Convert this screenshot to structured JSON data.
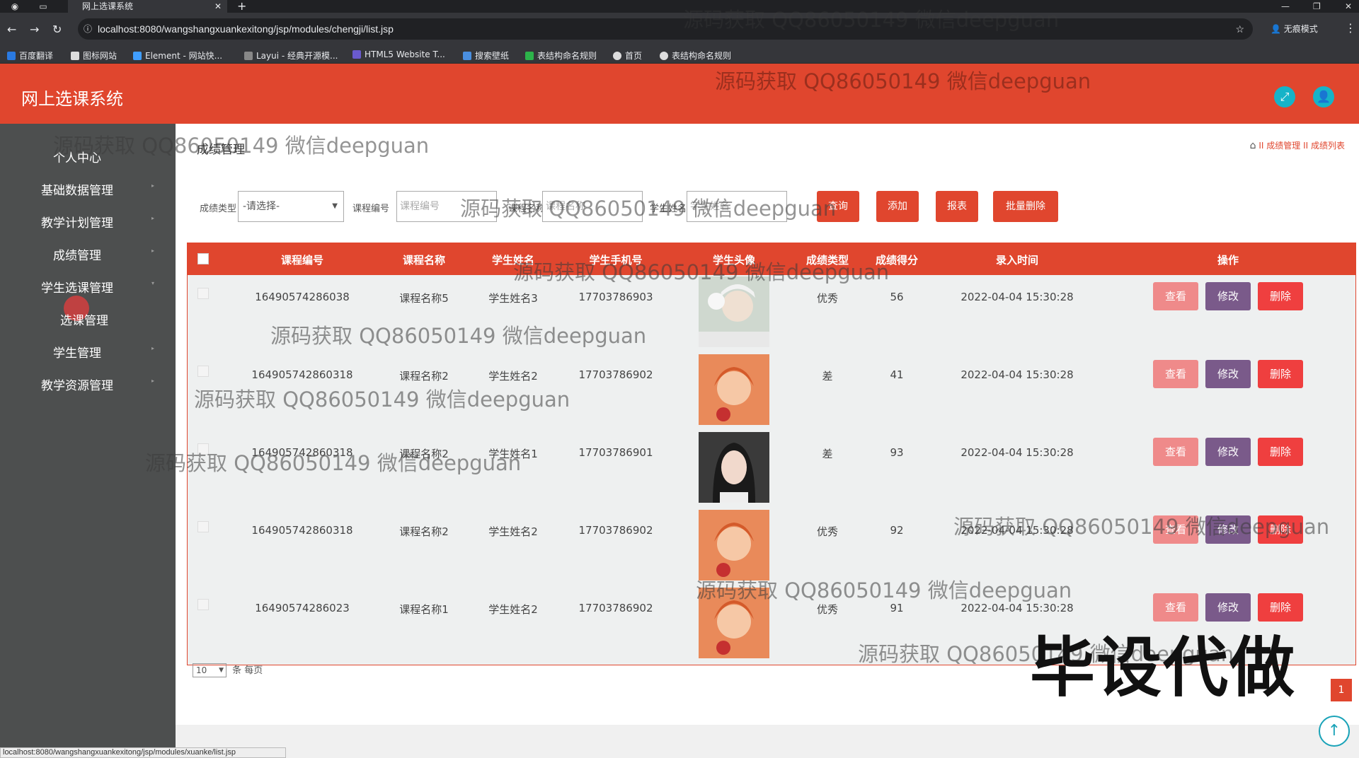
{
  "browser": {
    "tab_title": "网上选课系统",
    "url": "localhost:8080/wangshangxuankexitong/jsp/modules/chengji/list.jsp",
    "incognito_label": "无痕模式",
    "bookmarks": [
      "百度翻译",
      "图标网站",
      "Element - 网站快...",
      "Layui - 经典开源模...",
      "HTML5 Website T...",
      "搜索壁纸",
      "表结构命名规则",
      "首页",
      "表结构命名规则"
    ],
    "status_url": "localhost:8080/wangshangxuankexitong/jsp/modules/xuanke/list.jsp"
  },
  "app": {
    "title": "网上选课系统",
    "accent": "#e0462e"
  },
  "sidebar": {
    "items": [
      "个人中心",
      "基础数据管理",
      "教学计划管理",
      "成绩管理",
      "学生选课管理",
      "选课管理",
      "学生管理",
      "教学资源管理"
    ]
  },
  "page": {
    "title": "成绩管理",
    "breadcrumb": [
      "成绩管理",
      "成绩列表"
    ],
    "breadcrumb_sep": "II"
  },
  "filters": {
    "type_label": "成绩类型",
    "type_value": "-请选择-",
    "course_code_label": "课程编号",
    "course_code_placeholder": "课程编号",
    "course_name_label": "课程名称",
    "course_name_placeholder": "课程名称",
    "student_name_label": "学生姓名",
    "student_name_placeholder": "学生姓名",
    "buttons": [
      "查询",
      "添加",
      "报表",
      "批量删除"
    ]
  },
  "table": {
    "headers": [
      "课程编号",
      "课程名称",
      "学生姓名",
      "学生手机号",
      "学生头像",
      "成绩类型",
      "成绩得分",
      "录入时间",
      "操作"
    ],
    "action_labels": [
      "查看",
      "修改",
      "删除"
    ],
    "rows": [
      {
        "code": "16490574286038",
        "course": "课程名称5",
        "student": "学生姓名3",
        "phone": "17703786903",
        "type": "优秀",
        "score": "56",
        "time": "2022-04-04 15:30:28"
      },
      {
        "code": "164905742860318",
        "course": "课程名称2",
        "student": "学生姓名2",
        "phone": "17703786902",
        "type": "差",
        "score": "41",
        "time": "2022-04-04 15:30:28"
      },
      {
        "code": "164905742860318",
        "course": "课程名称2",
        "student": "学生姓名1",
        "phone": "17703786901",
        "type": "差",
        "score": "93",
        "time": "2022-04-04 15:30:28"
      },
      {
        "code": "164905742860318",
        "course": "课程名称2",
        "student": "学生姓名2",
        "phone": "17703786902",
        "type": "优秀",
        "score": "92",
        "time": "2022-04-04 15:30:28"
      },
      {
        "code": "16490574286023",
        "course": "课程名称1",
        "student": "学生姓名2",
        "phone": "17703786902",
        "type": "优秀",
        "score": "91",
        "time": "2022-04-04 15:30:28"
      }
    ]
  },
  "pager": {
    "page_size": "10",
    "per_page_label": "条 每页",
    "current_page": "1"
  },
  "watermarks": {
    "text": "源码获取 QQ86050149 微信deepguan",
    "big": "毕设代做"
  }
}
